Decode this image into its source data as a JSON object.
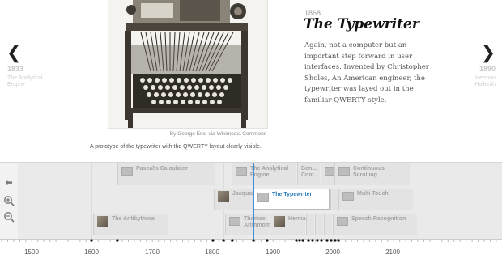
{
  "slide": {
    "prev": {
      "year": "1833",
      "title": "The Analytical Engine"
    },
    "next": {
      "year": "1890",
      "title": "Herman Hollerith"
    },
    "date": "1868",
    "headline": "The Typewriter",
    "body": "Again, not a computer but an important step forward in user interfaces. Invented by Christopher Sholes, An American engineer, the typewriter was layed out in the familiar QWERTY style.",
    "credit": "By George Eric, via Wikimedia Commons",
    "caption": "A prototype of the typewriter with the QWERTY layout clearly visible."
  },
  "toolbar": {
    "back_icon": "back-arrow-icon",
    "zoom_in_icon": "zoom-in-icon",
    "zoom_out_icon": "zoom-out-icon"
  },
  "timeline": {
    "markers": [
      {
        "label": "Pascal's Calculator",
        "thumb": "image-icon"
      },
      {
        "label": "The Analytical Engine",
        "thumb": "image-icon"
      },
      {
        "label": "Ben... Com...",
        "thumb": "image-icon"
      },
      {
        "label": "Continuous Scrolling",
        "thumb": "image-icon"
      },
      {
        "label": "Jacquard",
        "thumb": "photo"
      },
      {
        "label": "The Typewriter",
        "thumb": "image-icon"
      },
      {
        "label": "Multi Touch",
        "thumb": "image-icon"
      },
      {
        "label": "The Antikythera",
        "thumb": "photo"
      },
      {
        "label": "Thomas Arithmometer",
        "thumb": "image-icon"
      },
      {
        "label": "Herman",
        "thumb": "photo"
      },
      {
        "label": "Speech Recognition",
        "thumb": "image-icon"
      }
    ],
    "years": [
      "1500",
      "1600",
      "1700",
      "1800",
      "1900",
      "2000",
      "2100"
    ],
    "colors": {
      "active": "#3a8fd6",
      "marker_text": "#a3a3a3"
    }
  }
}
